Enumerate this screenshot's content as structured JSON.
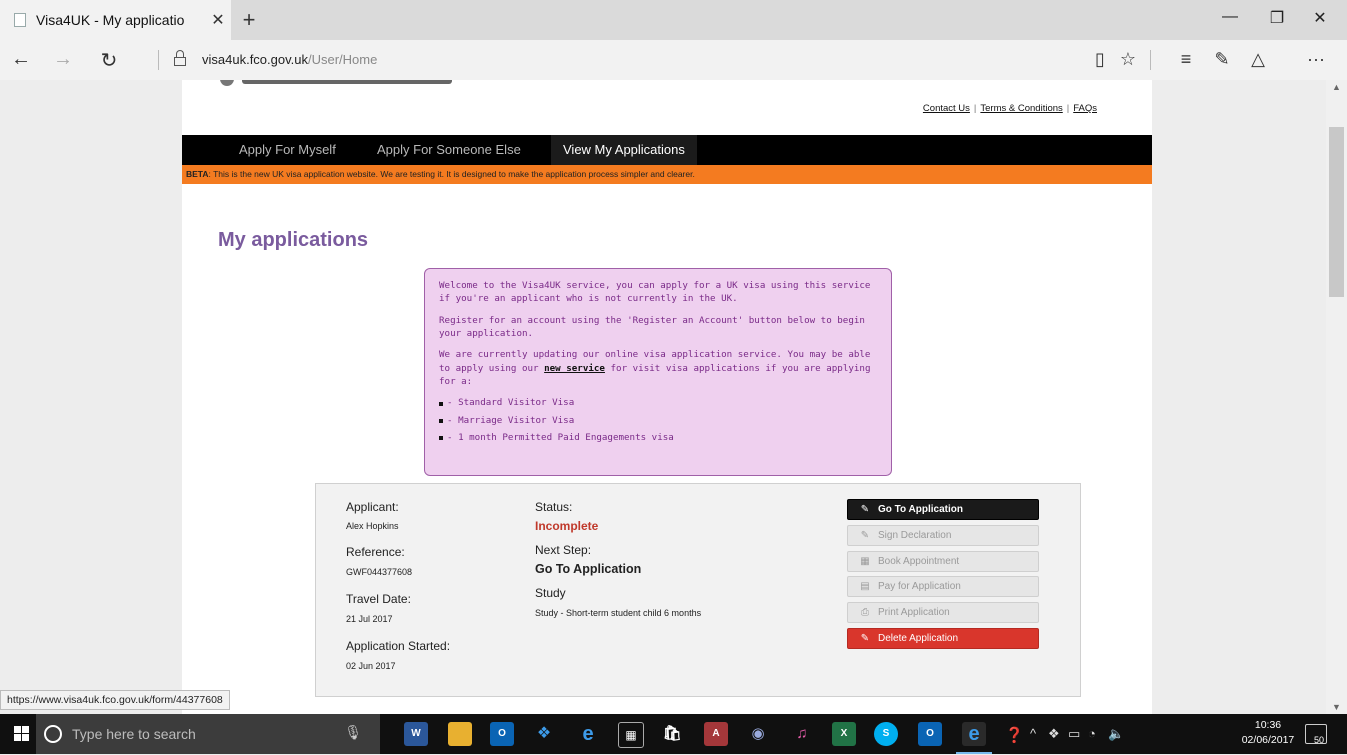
{
  "browser": {
    "tab_title": "Visa4UK - My applicatio",
    "tab_close": "✕",
    "new_tab": "+",
    "minimize": "—",
    "restore": "❐",
    "close": "✕",
    "back": "←",
    "forward": "→",
    "refresh": "↻",
    "url_host": "visa4uk.fco.gov.uk",
    "url_path": "/User/Home",
    "tools": {
      "reading": "▯",
      "favorite": "☆",
      "hub": "≡",
      "notes": "✎",
      "share": "△",
      "more": "···"
    }
  },
  "page": {
    "toplinks": {
      "contact": "Contact Us",
      "terms": "Terms & Conditions",
      "faqs": "FAQs",
      "pipe": "|"
    },
    "nav": {
      "myself": "Apply For Myself",
      "someone": "Apply For Someone Else",
      "view": "View My Applications"
    },
    "beta_label": "BETA",
    "beta_text": ": This is the new UK visa application website. We are testing it. It is designed to make the application process simpler and clearer.",
    "heading": "My applications",
    "notice": {
      "p1": "Welcome to the Visa4UK service, you can apply for a UK visa using this service if you're an applicant who is not currently in the UK.",
      "p2": "Register for an account using the 'Register an Account' button below to begin your application.",
      "p3_before": "We are currently updating our online visa application service. You may be able to apply using our ",
      "p3_link": "new service",
      "p3_after": " for visit visa applications if you are applying for a:",
      "items": [
        "- Standard Visitor Visa",
        "- Marriage Visitor Visa",
        "- 1 month Permitted Paid Engagements visa"
      ]
    },
    "application": {
      "applicant_label": "Applicant:",
      "applicant": "Alex Hopkins",
      "reference_label": "Reference:",
      "reference": "GWF044377608",
      "travel_label": "Travel Date:",
      "travel": "21 Jul 2017",
      "started_label": "Application Started:",
      "started": "02 Jun 2017",
      "status_label": "Status:",
      "status": "Incomplete",
      "next_label": "Next Step:",
      "next": "Go To Application",
      "type_label": "Study",
      "type": "Study - Short-term student child 6 months",
      "buttons": {
        "go": "Go To Application",
        "sign": "Sign Declaration",
        "book": "Book Appointment",
        "pay": "Pay for Application",
        "print": "Print Application",
        "delete": "Delete Application"
      }
    },
    "status_url": "https://www.visa4uk.fco.gov.uk/form/44377608"
  },
  "taskbar": {
    "search_placeholder": "Type here to search",
    "time": "10:36",
    "date": "02/06/2017",
    "notifications": "50"
  },
  "colors": {
    "heading": "#7a5b9e",
    "beta_bar": "#f47b20",
    "notice_bg": "#efd0ef",
    "status_incomplete": "#c0392b",
    "delete_button": "#d9362c"
  }
}
